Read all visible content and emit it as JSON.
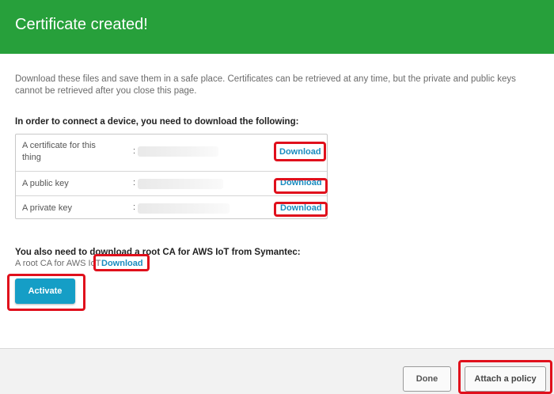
{
  "header": {
    "title": "Certificate created!",
    "bg_color": "#27a03b"
  },
  "intro_text": "Download these files and save them in a safe place. Certificates can be retrieved at any time, but the private and public keys cannot be retrieved after you close this page.",
  "files_section": {
    "heading": "In order to connect a device, you need to download the following:",
    "rows": [
      {
        "label": "A certificate for this thing",
        "separator": ":",
        "download_label": "Download"
      },
      {
        "label": "A public key",
        "separator": ":",
        "download_label": "Download"
      },
      {
        "label": "A private key",
        "separator": ":",
        "download_label": "Download"
      }
    ]
  },
  "root_ca": {
    "heading": "You also need to download a root CA for AWS IoT from Symantec:",
    "text": "A root CA for AWS IoT",
    "download_label": "Download"
  },
  "actions": {
    "activate_label": "Activate",
    "done_label": "Done",
    "attach_policy_label": "Attach a policy"
  },
  "colors": {
    "link": "#1a8cbf",
    "primary_button": "#159ec6",
    "highlight": "#e0101c"
  }
}
